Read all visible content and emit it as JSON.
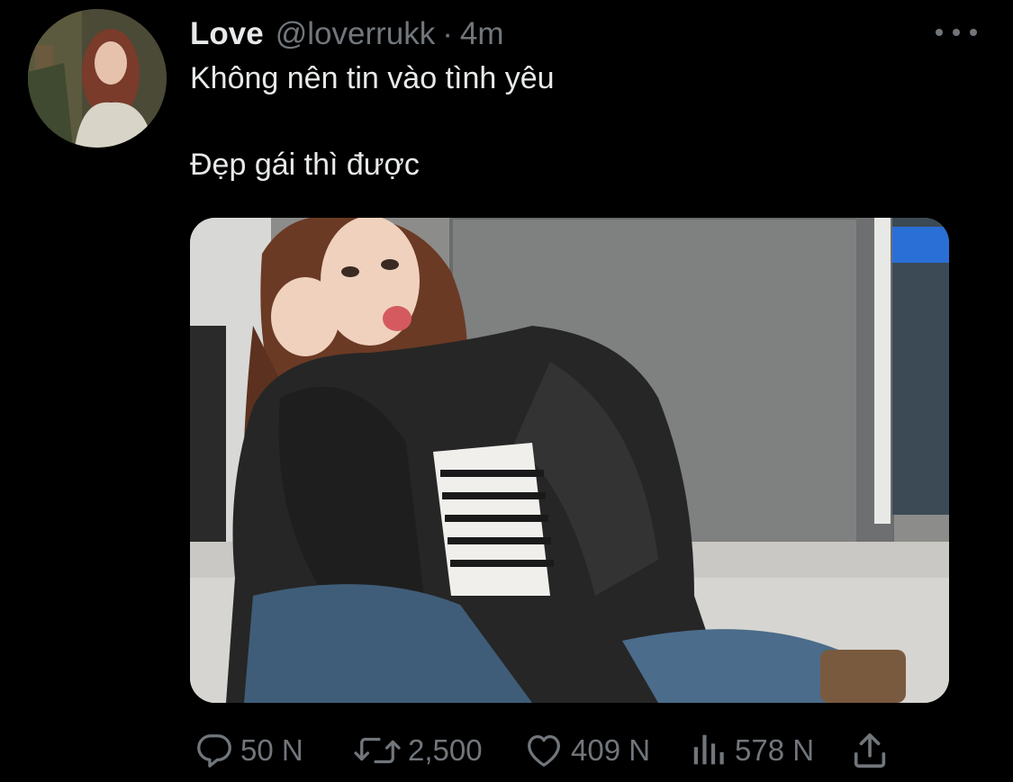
{
  "tweet": {
    "display_name": "Love",
    "handle": "@loverrukk",
    "separator": "·",
    "time": "4m",
    "text_line_1": "Không nên tin vào tình yêu",
    "text_line_2": "Đẹp gái thì được"
  },
  "icons": {
    "more": "more-horizontal-icon",
    "reply": "reply-icon",
    "retweet": "retweet-icon",
    "like": "heart-icon",
    "views": "views-icon",
    "share": "share-icon"
  },
  "actions": {
    "reply_count": "50 N",
    "retweet_count": "2,500",
    "like_count": "409 N",
    "views_count": "578 N"
  },
  "colors": {
    "background": "#000000",
    "primary_text": "#e7e9ea",
    "secondary_text": "#71767b"
  }
}
